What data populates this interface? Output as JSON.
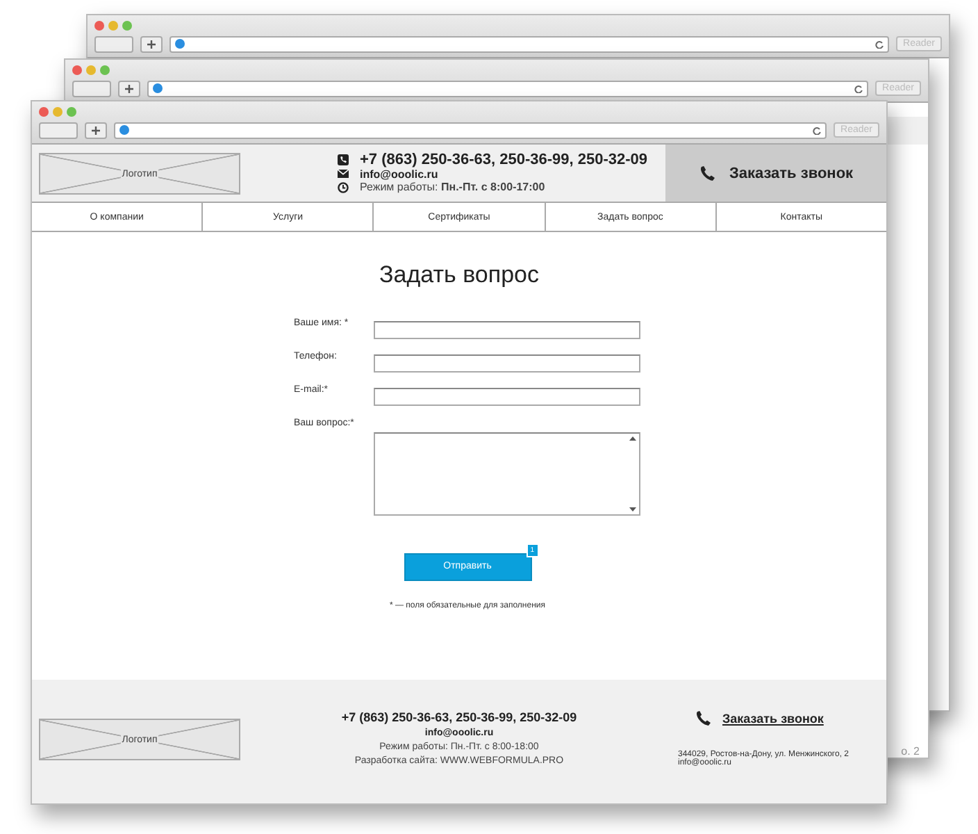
{
  "back_windows": [
    {
      "reader": "Reader"
    },
    {
      "reader": "Reader",
      "fragment": "о. 2"
    }
  ],
  "window": {
    "reader": "Reader"
  },
  "header": {
    "logo": "Логотип",
    "phone": "+7 (863) 250-36-63, 250-36-99, 250-32-09",
    "email": "info@ooolic.ru",
    "hours": "Режим работы: **Пн.-Пт. с 8:00-17:00**",
    "callback": "Заказать звонок"
  },
  "nav": [
    "О компании",
    "Услуги",
    "Сертификаты",
    "Задать вопрос",
    "Контакты"
  ],
  "form": {
    "title": "Задать вопрос",
    "fields": [
      {
        "label": "Ваше имя: *",
        "kind": "text"
      },
      {
        "label": "Телефон:",
        "kind": "text"
      },
      {
        "label": "E-mail:*",
        "kind": "text"
      },
      {
        "label": "Ваш вопрос:*",
        "kind": "textarea"
      }
    ],
    "submit": "Отправить",
    "badge": "1",
    "note": "* — поля обязательные для заполнения"
  },
  "footer": {
    "logo": "Логотип",
    "phone": "+7 (863) 250-36-63, 250-36-99, 250-32-09",
    "email": "info@ooolic.ru",
    "hours": "Режим работы: Пн.-Пт. с 8:00-18:00",
    "dev": "Разработка сайта: WWW.WEBFORMULA.PRO",
    "callback": "Заказать звонок",
    "address": "344029, Ростов-на-Дону, ул. Менжинского, 2",
    "email2": "info@ooolic.ru"
  }
}
